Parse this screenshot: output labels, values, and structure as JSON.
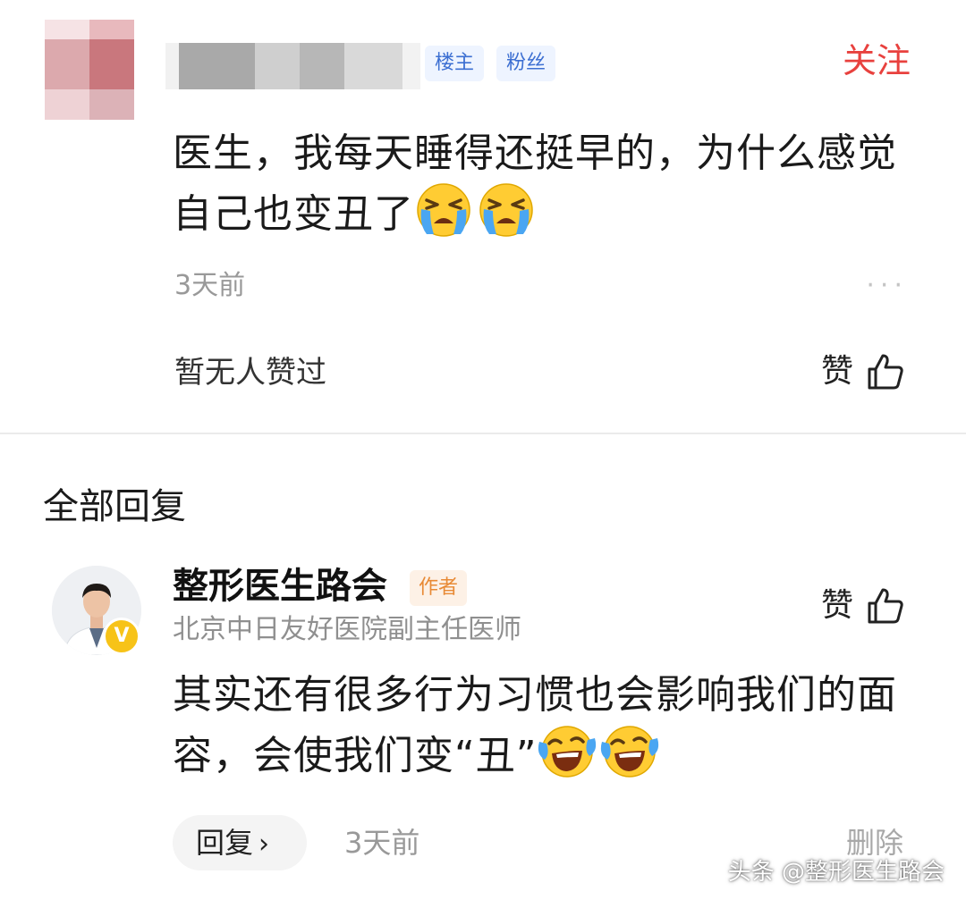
{
  "original_comment": {
    "badges": [
      "楼主",
      "粉丝"
    ],
    "follow_label": "关注",
    "text": "医生，我每天睡得还挺早的，为什么感觉自己也变丑了",
    "emoji": "crying-face",
    "time": "3天前",
    "more": "···",
    "likes_status": "暂无人赞过",
    "like_label": "赞"
  },
  "replies": {
    "section_title": "全部回复",
    "items": [
      {
        "author": "整形医生路会",
        "author_tag": "作者",
        "subtitle": "北京中日友好医院副主任医师",
        "verified_mark": "V",
        "like_label": "赞",
        "text": "其实还有很多行为习惯也会影响我们的面容，会使我们变“丑”",
        "emoji": "laughing-crying-face",
        "reply_label": "回复",
        "reply_chevron": "›",
        "time": "3天前",
        "delete_label": "删除"
      }
    ]
  },
  "watermark": "头条 @整形医生路会",
  "colors": {
    "follow": "#e8413e",
    "badge_bg": "#eef4ff",
    "badge_text": "#3c6fd2",
    "author_tag_bg": "#fdf1e6",
    "author_tag_text": "#e88a35",
    "verified": "#f7c318"
  }
}
